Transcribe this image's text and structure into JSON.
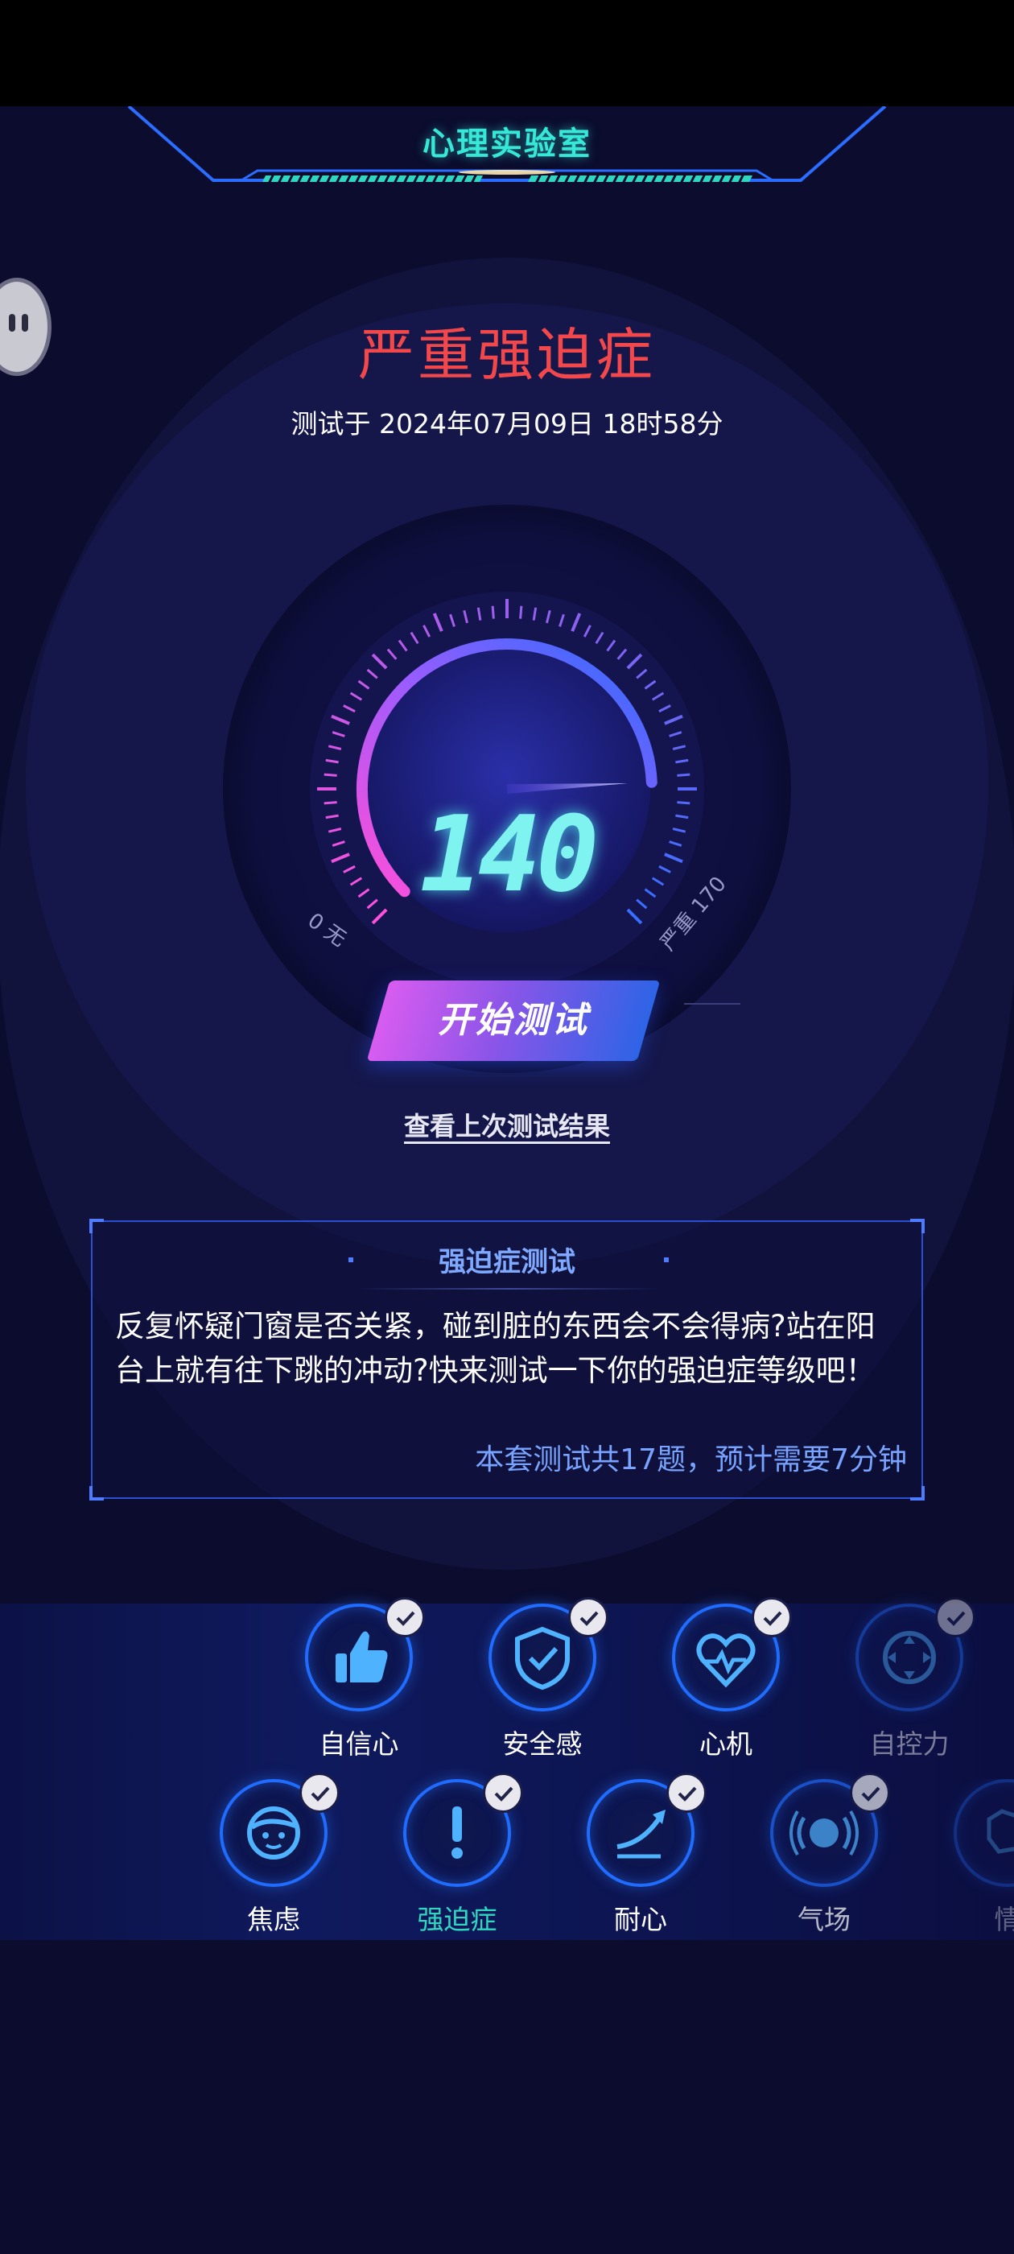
{
  "header": {
    "title": "心理实验室"
  },
  "result": {
    "level": "严重强迫症",
    "test_time": "测试于 2024年07月09日 18时58分",
    "score": "140",
    "score_value": 140,
    "gauge_min": "0",
    "gauge_min_label": "无",
    "gauge_max": "170",
    "gauge_max_label": "严重"
  },
  "actions": {
    "start_test": "开始测试",
    "view_last_result": "查看上次测试结果"
  },
  "card": {
    "title": "强迫症测试",
    "description": "反复怀疑门窗是否关紧，碰到脏的东西会不会得病?站在阳台上就有往下跳的冲动?快来测试一下你的强迫症等级吧！",
    "info": "本套测试共17题，预计需要7分钟"
  },
  "tests_row1": [
    {
      "label": "自信心",
      "icon": "thumbs-up-icon",
      "completed": true
    },
    {
      "label": "安全感",
      "icon": "shield-check-icon",
      "completed": true
    },
    {
      "label": "心机",
      "icon": "heart-pulse-icon",
      "completed": true
    },
    {
      "label": "自控力",
      "icon": "control-pad-icon",
      "completed": true
    }
  ],
  "tests_row2": [
    {
      "label": "焦虑",
      "icon": "face-icon",
      "completed": true
    },
    {
      "label": "强迫症",
      "icon": "exclamation-icon",
      "completed": true,
      "active": true
    },
    {
      "label": "耐心",
      "icon": "trend-arrow-icon",
      "completed": true
    },
    {
      "label": "气场",
      "icon": "aura-icon",
      "completed": true
    },
    {
      "label": "情",
      "icon": "emotion-icon",
      "completed": false
    }
  ],
  "colors": {
    "background": "#0b0c2e",
    "level_red": "#f2484b",
    "accent_teal": "#35e8d8",
    "accent_blue": "#1f6cff"
  }
}
